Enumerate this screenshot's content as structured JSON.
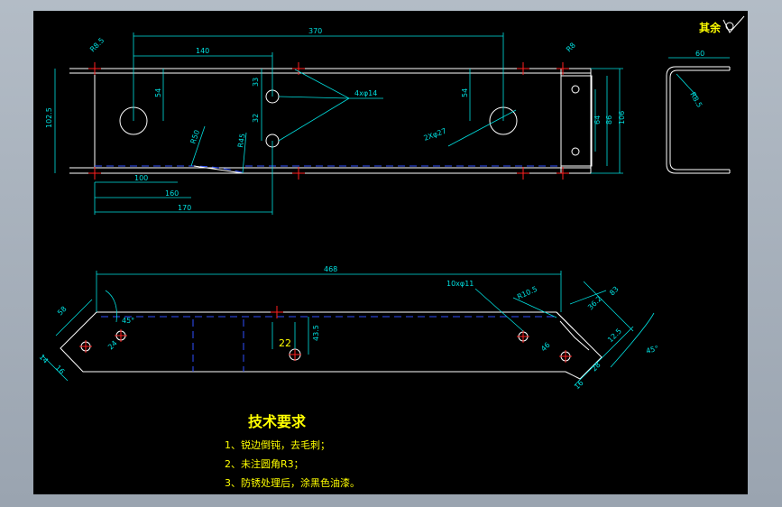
{
  "dims": {
    "d_370": "370",
    "d_140": "140",
    "d_r8_5_tl": "R8.5",
    "d_r8_5_tr": "R8",
    "d_54_left": "54",
    "d_54_right": "54",
    "d_33": "33",
    "d_32": "32",
    "d_4x14": "4xφ14",
    "d_2x27": "2Xφ27",
    "d_102_5": "102.5",
    "d_r50": "R50",
    "d_r45": "R45",
    "d_100": "100",
    "d_160": "160",
    "d_170": "170",
    "d_64": "64",
    "d_86": "86",
    "d_106": "106",
    "d_60": "60",
    "d_r8_5_sec": "R8.5",
    "d_468": "468",
    "d_10x11": "10xφ11",
    "d_r10_5": "R10.5",
    "d_36_2": "36.2",
    "d_83": "83",
    "d_58": "58",
    "d_45deg_left": "45°",
    "d_45deg_right": "45°",
    "d_22": "22",
    "d_43_5": "43.5",
    "d_14_a": "14",
    "d_16_a": "16",
    "d_24": "24",
    "d_46": "46",
    "d_12_5": "12.5",
    "d_28": "28",
    "d_16_b": "16"
  },
  "rest_label": "其余",
  "notes": {
    "title": "技术要求",
    "items": [
      "1、锐边倒钝，去毛刺；",
      "2、未注圆角R3；",
      "3、防锈处理后，涂黑色油漆。"
    ]
  },
  "colors": {
    "background": "#000000",
    "outline": "#ffffff",
    "dimension": "#00e0e0",
    "hidden_line": "#3050ff",
    "center_mark": "#ff2020",
    "note_text": "#ffff00"
  }
}
